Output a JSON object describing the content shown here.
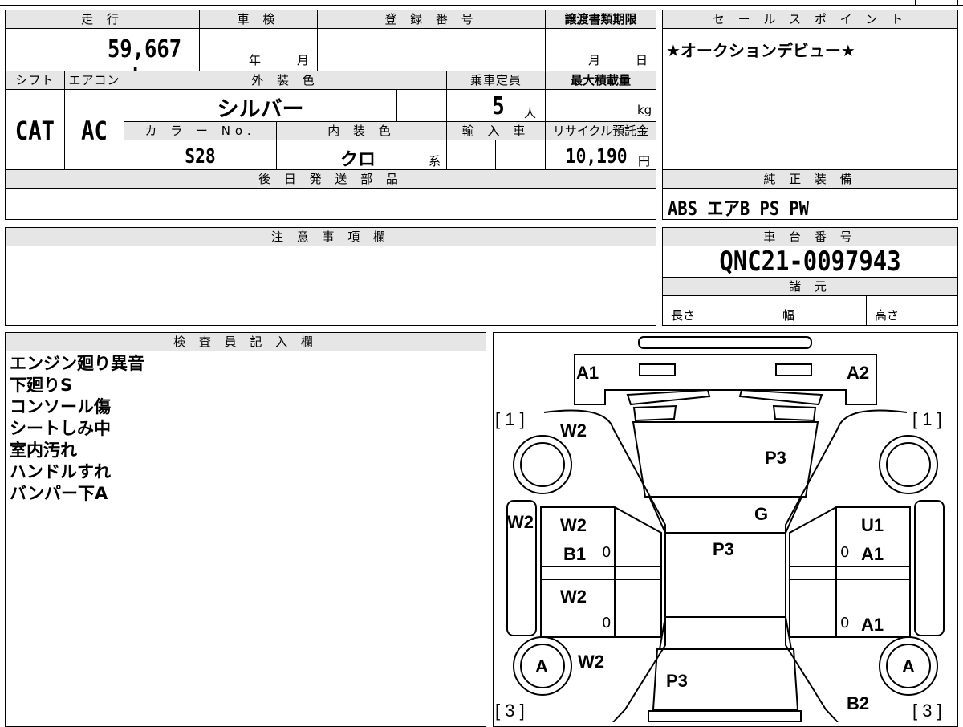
{
  "top_section": {
    "mileage_label": "走 行",
    "mileage_value": "59,667 km",
    "shaken_label": "車 検",
    "shaken_year": "年",
    "shaken_month": "月",
    "reg_label": "登 録 番 号",
    "transfer_label": "譲渡書類期限",
    "transfer_month": "月",
    "transfer_day": "日",
    "shift_label": "シフト",
    "shift_value": "CAT",
    "aircon_label": "エアコン",
    "aircon_value": "AC",
    "exterior_label": "外 装 色",
    "exterior_value": "シルバー",
    "capacity_label": "乗車定員",
    "capacity_value": "5",
    "capacity_unit": "人",
    "maxload_label": "最大積載量",
    "maxload_unit": "kg",
    "color_no_label": "カ ラ ー No.",
    "color_no_value": "S28",
    "interior_label": "内 装 色",
    "interior_value": "クロ",
    "interior_suffix": "系",
    "import_label": "輸 入 車",
    "recycle_label": "リサイクル預託金",
    "recycle_value": "10,190",
    "recycle_unit": "円",
    "later_parts_label": "後 日 発 送 部 品"
  },
  "sales_point": {
    "label": "セ ー ル ス ポ イ ン ト",
    "text": "★オークションデビュー★"
  },
  "equipment": {
    "label": "純 正 装 備",
    "text": "ABS エアB PS PW"
  },
  "notes": {
    "label": "注 意 事 項 欄"
  },
  "chassis": {
    "label": "車 台 番 号",
    "value": "QNC21-0097943",
    "spec_label": "諸 元",
    "length_label": "長さ",
    "width_label": "幅",
    "height_label": "高さ"
  },
  "inspector": {
    "label": "検 査 員 記 入 欄",
    "lines": [
      "エンジン廻り異音",
      "下廻りS",
      "コンソール傷",
      "シートしみ中",
      "室内汚れ",
      "ハンドルすれ",
      "バンパー下A"
    ]
  },
  "diagram": {
    "marks": {
      "front_left": "A1",
      "front_right": "A2",
      "bracket_tl": "[ 1 ]",
      "bracket_tr": "[ 1 ]",
      "bracket_bl": "[ 3 ]",
      "bracket_br": "[ 3 ]",
      "fender_fl": "W2",
      "hood": "P3",
      "cowl": "G",
      "sill_left": "W2",
      "door_fl_w": "W2",
      "door_fl_b": "B1",
      "door_rl": "W2",
      "roof": "P3",
      "door_fr": "U1",
      "door_fr_a": "A1",
      "door_rr_a": "A1",
      "fender_rl": "W2",
      "trunk": "P3",
      "wheel_rl": "A",
      "wheel_rr": "A",
      "rear_right": "B2",
      "zero_1": "0",
      "zero_2": "0",
      "zero_3": "0",
      "zero_4": "0"
    }
  }
}
